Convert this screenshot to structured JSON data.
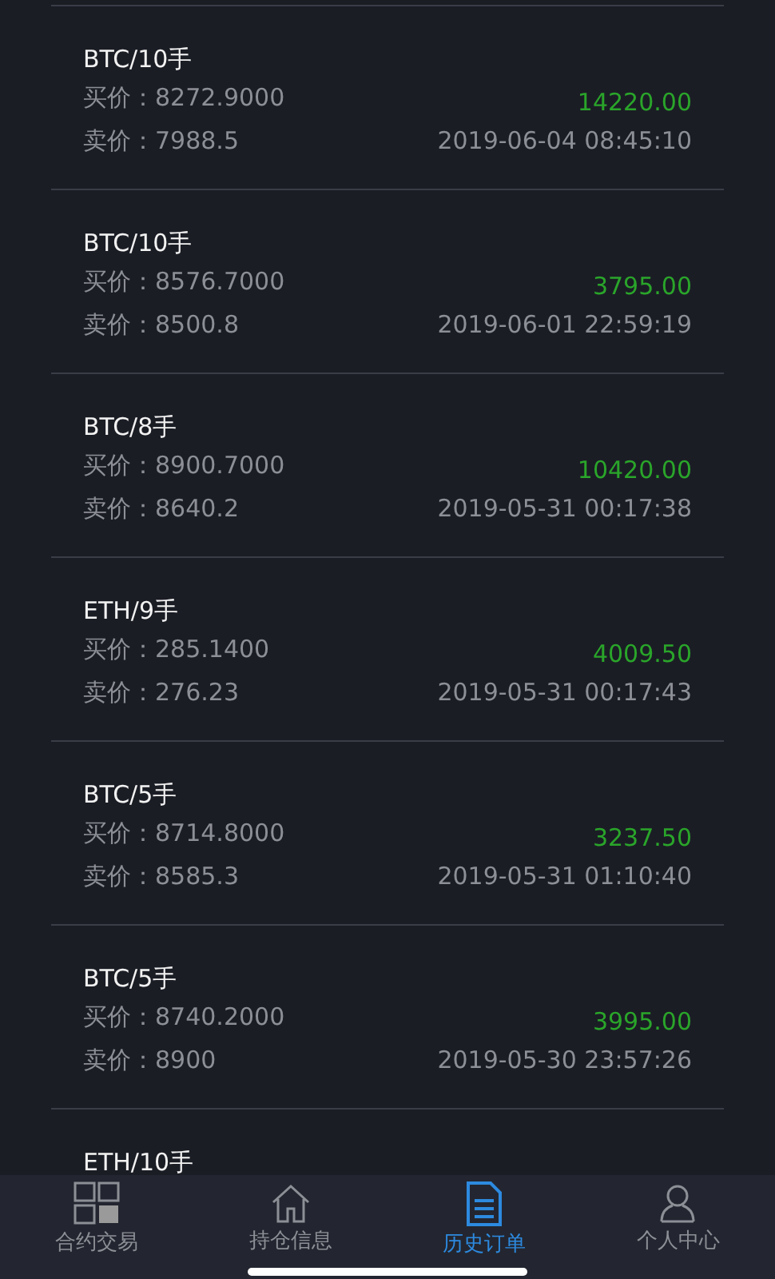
{
  "orders": [
    {
      "title": "BTC/10手",
      "buy_label": "买价：",
      "buy": "8272.9000",
      "sell_label": "卖价：",
      "sell": "7988.5",
      "profit": "14220.00",
      "time": "2019-06-04 08:45:10"
    },
    {
      "title": "BTC/10手",
      "buy_label": "买价：",
      "buy": "8576.7000",
      "sell_label": "卖价：",
      "sell": "8500.8",
      "profit": "3795.00",
      "time": "2019-06-01 22:59:19"
    },
    {
      "title": "BTC/8手",
      "buy_label": "买价：",
      "buy": "8900.7000",
      "sell_label": "卖价：",
      "sell": "8640.2",
      "profit": "10420.00",
      "time": "2019-05-31 00:17:38"
    },
    {
      "title": "ETH/9手",
      "buy_label": "买价：",
      "buy": "285.1400",
      "sell_label": "卖价：",
      "sell": "276.23",
      "profit": "4009.50",
      "time": "2019-05-31 00:17:43"
    },
    {
      "title": "BTC/5手",
      "buy_label": "买价：",
      "buy": "8714.8000",
      "sell_label": "卖价：",
      "sell": "8585.3",
      "profit": "3237.50",
      "time": "2019-05-31 01:10:40"
    },
    {
      "title": "BTC/5手",
      "buy_label": "买价：",
      "buy": "8740.2000",
      "sell_label": "卖价：",
      "sell": "8900",
      "profit": "3995.00",
      "time": "2019-05-30 23:57:26"
    },
    {
      "title": "ETH/10手"
    }
  ],
  "tabs": [
    {
      "kind": "grid",
      "label": "合约交易",
      "selected": false
    },
    {
      "kind": "house",
      "label": "持仓信息",
      "selected": false
    },
    {
      "kind": "document",
      "label": "历史订单",
      "selected": true
    },
    {
      "kind": "person",
      "label": "个人中心",
      "selected": false
    }
  ]
}
